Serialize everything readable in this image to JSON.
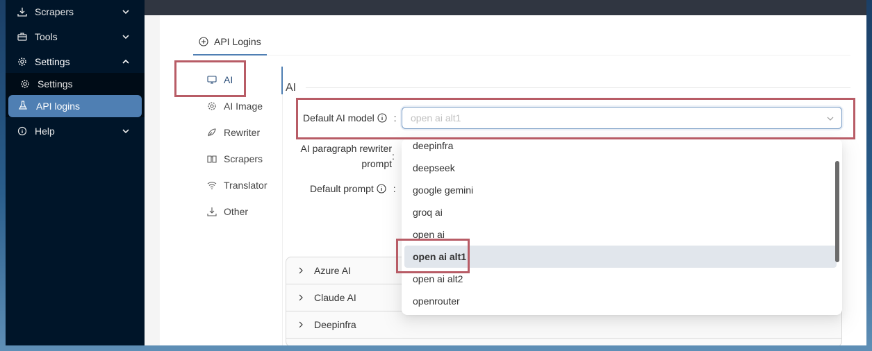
{
  "sidebar": {
    "items": [
      {
        "label": "Scrapers",
        "icon": "download-icon"
      },
      {
        "label": "Tools",
        "icon": "toolbox-icon"
      },
      {
        "label": "Settings",
        "icon": "gear-icon"
      },
      {
        "label": "Help",
        "icon": "info-icon"
      }
    ],
    "settings_submenu": [
      {
        "label": "Settings",
        "icon": "gear-icon"
      },
      {
        "label": "API logins",
        "icon": "flask-icon"
      }
    ]
  },
  "tabs": {
    "api_logins": "API Logins"
  },
  "vertical_tabs": [
    {
      "label": "AI",
      "icon": "monitor-icon"
    },
    {
      "label": "AI Image",
      "icon": "gear-icon"
    },
    {
      "label": "Rewriter",
      "icon": "rewrite-icon"
    },
    {
      "label": "Scrapers",
      "icon": "book-icon"
    },
    {
      "label": "Translator",
      "icon": "wifi-icon"
    },
    {
      "label": "Other",
      "icon": "download-icon"
    }
  ],
  "section": {
    "title": "AI"
  },
  "form": {
    "default_ai_model_label": "Default AI model",
    "rewriter_prompt_label_line1": "AI paragraph rewriter",
    "rewriter_prompt_label_line2": "prompt",
    "default_prompt_label": "Default prompt",
    "colon": ":",
    "select_placeholder": "open ai alt1"
  },
  "dropdown": {
    "options": [
      "deepinfra",
      "deepseek",
      "google gemini",
      "groq ai",
      "open ai",
      "open ai alt1",
      "open ai alt2",
      "openrouter"
    ],
    "selected": "open ai alt1"
  },
  "providers": [
    "Azure AI",
    "Claude AI",
    "Deepinfra"
  ],
  "colors": {
    "sidebar_bg": "#001529",
    "accent": "#4f7fb3",
    "highlight_box": "#b85c66"
  }
}
